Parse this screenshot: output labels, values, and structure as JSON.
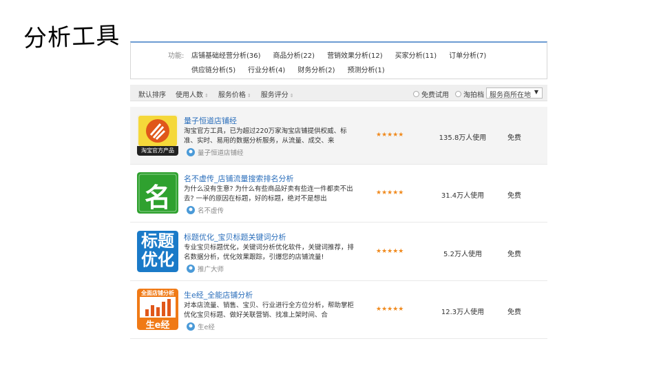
{
  "slide": {
    "title": "分析工具"
  },
  "filters": {
    "label": "功能:",
    "row1": [
      "店铺基础经营分析(36)",
      "商品分析(22)",
      "营销效果分析(12)",
      "买家分析(11)",
      "订单分析(7)"
    ],
    "row2": [
      "供应链分析(5)",
      "行业分析(4)",
      "财务分析(2)",
      "预测分析(1)"
    ]
  },
  "sortbar": {
    "default": "默认排序",
    "users": "使用人数",
    "price": "服务价格",
    "rating": "服务评分",
    "free_trial": "免费试用",
    "taopai": "淘拍档",
    "location_dropdown": "服务商所在地"
  },
  "apps": [
    {
      "name": "量子恒道店铺经",
      "desc": "淘宝官方工具，已为超过220万家淘宝店铺提供权威、标准、实时、易用的数据分析服务，从流量、成交、来",
      "vendor": "量子恒道店铺经",
      "stars": "★★★★★",
      "users": "135.8万人使用",
      "price": "免费",
      "icon": "liangzi-icon",
      "icon_caption": "淘宝官方产品",
      "color": "#e0571a"
    },
    {
      "name": "名不虚传_店铺流量搜索排名分析",
      "desc": "为什么没有生意? 为什么有些商品好卖有些连一件都卖不出去? 一半的原因在标题，好的标题，绝对不是想出",
      "vendor": "名不虚传",
      "stars": "★★★★★",
      "users": "31.4万人使用",
      "price": "免费",
      "icon": "ming-icon",
      "icon_caption": "名",
      "color": "#2fa12f"
    },
    {
      "name": "标题优化_宝贝标题关键词分析",
      "desc": "专业宝贝标题优化，关键词分析优化软件，关键词推荐，排名数据分析，优化效果跟踪，引爆您的店铺流量!",
      "vendor": "推广大师",
      "stars": "★★★★★",
      "users": "5.2万人使用",
      "price": "免费",
      "icon": "biaoti-icon",
      "icon_caption": "标题优化",
      "color": "#1a7ac8"
    },
    {
      "name": "生e经_全能店铺分析",
      "desc": "对本店流量、销售、宝贝、行业进行全方位分析，帮助掌柜优化宝贝标题、做好关联营销、找准上架时间、合",
      "vendor": "生e经",
      "stars": "★★★★★",
      "users": "12.3万人使用",
      "price": "免费",
      "icon": "shengejing-icon",
      "icon_caption": "全面店铺分析",
      "icon_caption2": "生e经",
      "color": "#f07a16"
    }
  ]
}
